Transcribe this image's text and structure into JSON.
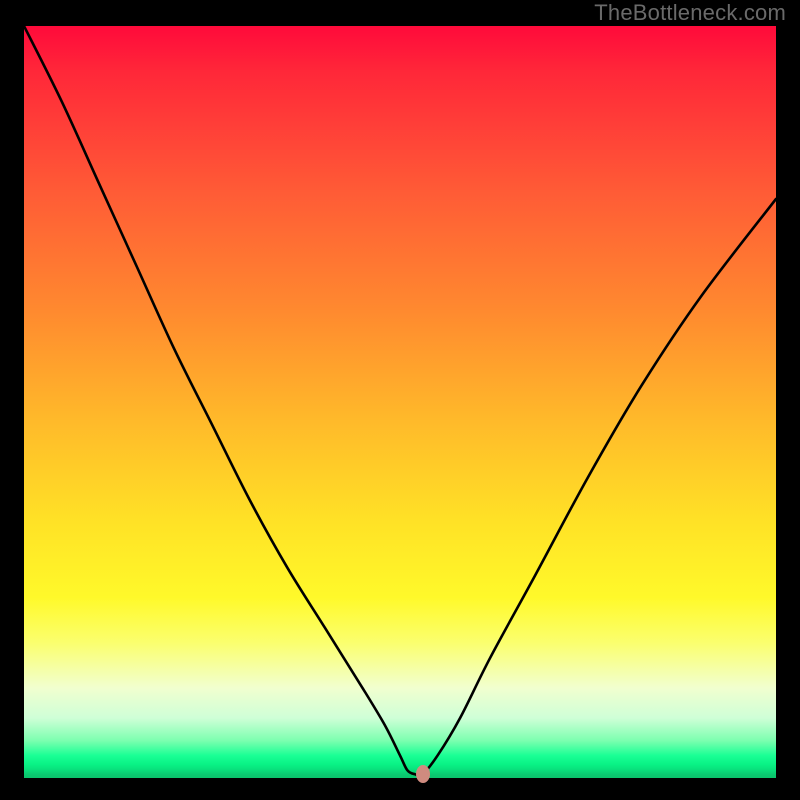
{
  "watermark": "TheBottleneck.com",
  "chart_data": {
    "type": "line",
    "title": "",
    "xlabel": "",
    "ylabel": "",
    "xlim": [
      0,
      100
    ],
    "ylim": [
      0,
      100
    ],
    "grid": false,
    "legend": false,
    "series": [
      {
        "name": "bottleneck-curve",
        "x": [
          0,
          5,
          10,
          15,
          20,
          25,
          30,
          35,
          40,
          45,
          48,
          50,
          51,
          52,
          53,
          55,
          58,
          62,
          68,
          75,
          82,
          90,
          100
        ],
        "y": [
          100,
          90,
          79,
          68,
          57,
          47,
          37,
          28,
          20,
          12,
          7,
          3,
          1,
          0.5,
          0.5,
          3,
          8,
          16,
          27,
          40,
          52,
          64,
          77
        ]
      }
    ],
    "marker": {
      "x": 53,
      "y": 0.5,
      "color": "#cf8b7f"
    },
    "background_gradient": {
      "top": "#ff0a3a",
      "mid": "#fff92a",
      "bottom": "#0bc36c"
    }
  }
}
